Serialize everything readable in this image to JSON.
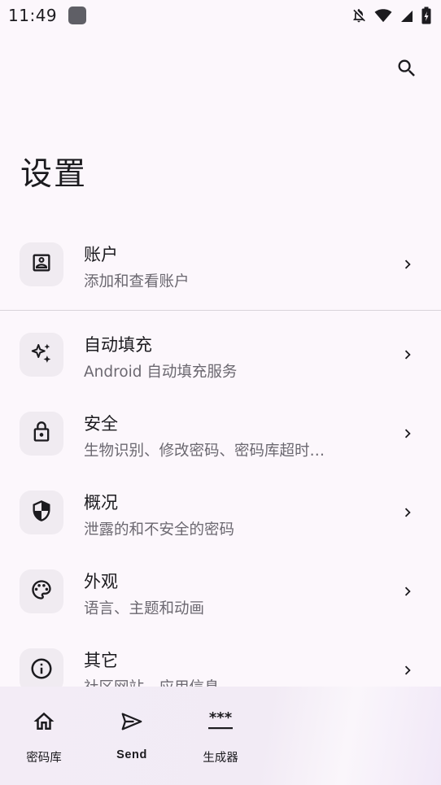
{
  "status_bar": {
    "time": "11:49",
    "icons": [
      "app-notification-icon",
      "bell-off-icon",
      "wifi-icon",
      "signal-icon",
      "battery-charging-icon"
    ]
  },
  "header": {
    "search_icon": "search-icon",
    "title": "设置"
  },
  "settings": [
    {
      "id": "account",
      "title": "账户",
      "subtitle": "添加和查看账户",
      "icon": "account-box-icon"
    },
    {
      "id": "autofill",
      "title": "自动填充",
      "subtitle": "Android 自动填充服务",
      "icon": "sparkle-icon"
    },
    {
      "id": "security",
      "title": "安全",
      "subtitle": "生物识别、修改密码、密码库超时…",
      "icon": "lock-icon"
    },
    {
      "id": "overview",
      "title": "概况",
      "subtitle": "泄露的和不安全的密码",
      "icon": "shield-icon"
    },
    {
      "id": "appearance",
      "title": "外观",
      "subtitle": "语言、主题和动画",
      "icon": "palette-icon"
    },
    {
      "id": "other",
      "title": "其它",
      "subtitle": "社区网站、应用信息",
      "icon": "info-icon"
    }
  ],
  "bottom_nav": [
    {
      "label": "密码库",
      "icon": "home-icon"
    },
    {
      "label": "Send",
      "icon": "send-icon"
    },
    {
      "label": "生成器",
      "icon": "password-generator-icon"
    }
  ],
  "colors": {
    "background": "#fcf7fc",
    "icon_tile": "#f0ebf1",
    "text_primary": "#1c1b1f",
    "text_secondary": "#6b6870",
    "divider": "#d9d4da"
  }
}
